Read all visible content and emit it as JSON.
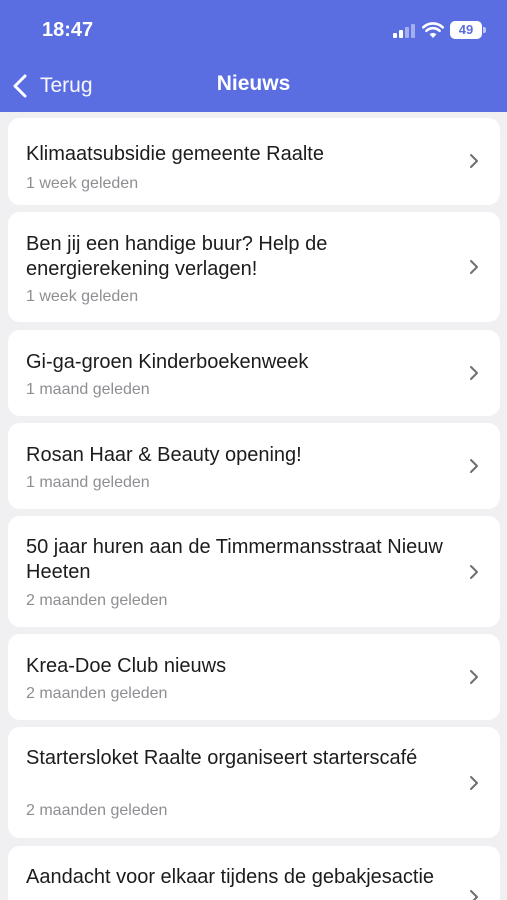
{
  "status_bar": {
    "time": "18:47",
    "battery": "49"
  },
  "nav": {
    "back_label": "Terug",
    "title": "Nieuws"
  },
  "colors": {
    "header": "#5b6ee1",
    "background": "#f0f0f3",
    "card": "#ffffff",
    "meta_text": "#8e8e93"
  },
  "news": [
    {
      "title": "Klimaatsubsidie gemeente Raalte",
      "age": "1 week geleden"
    },
    {
      "title": "Ben jij een handige buur? Help de energierekening verlagen!",
      "age": "1 week geleden"
    },
    {
      "title": "Gi-ga-groen Kinderboekenweek",
      "age": "1 maand geleden"
    },
    {
      "title": "Rosan Haar & Beauty opening!",
      "age": "1 maand geleden"
    },
    {
      "title": "50 jaar huren aan de Timmermansstraat Nieuw Heeten",
      "age": "2 maanden geleden"
    },
    {
      "title": "Krea-Doe Club nieuws",
      "age": "2 maanden geleden"
    },
    {
      "title": "Startersloket Raalte organiseert starterscafé",
      "age": "2 maanden geleden"
    },
    {
      "title": "Aandacht voor elkaar tijdens de gebakjesactie"
    }
  ]
}
